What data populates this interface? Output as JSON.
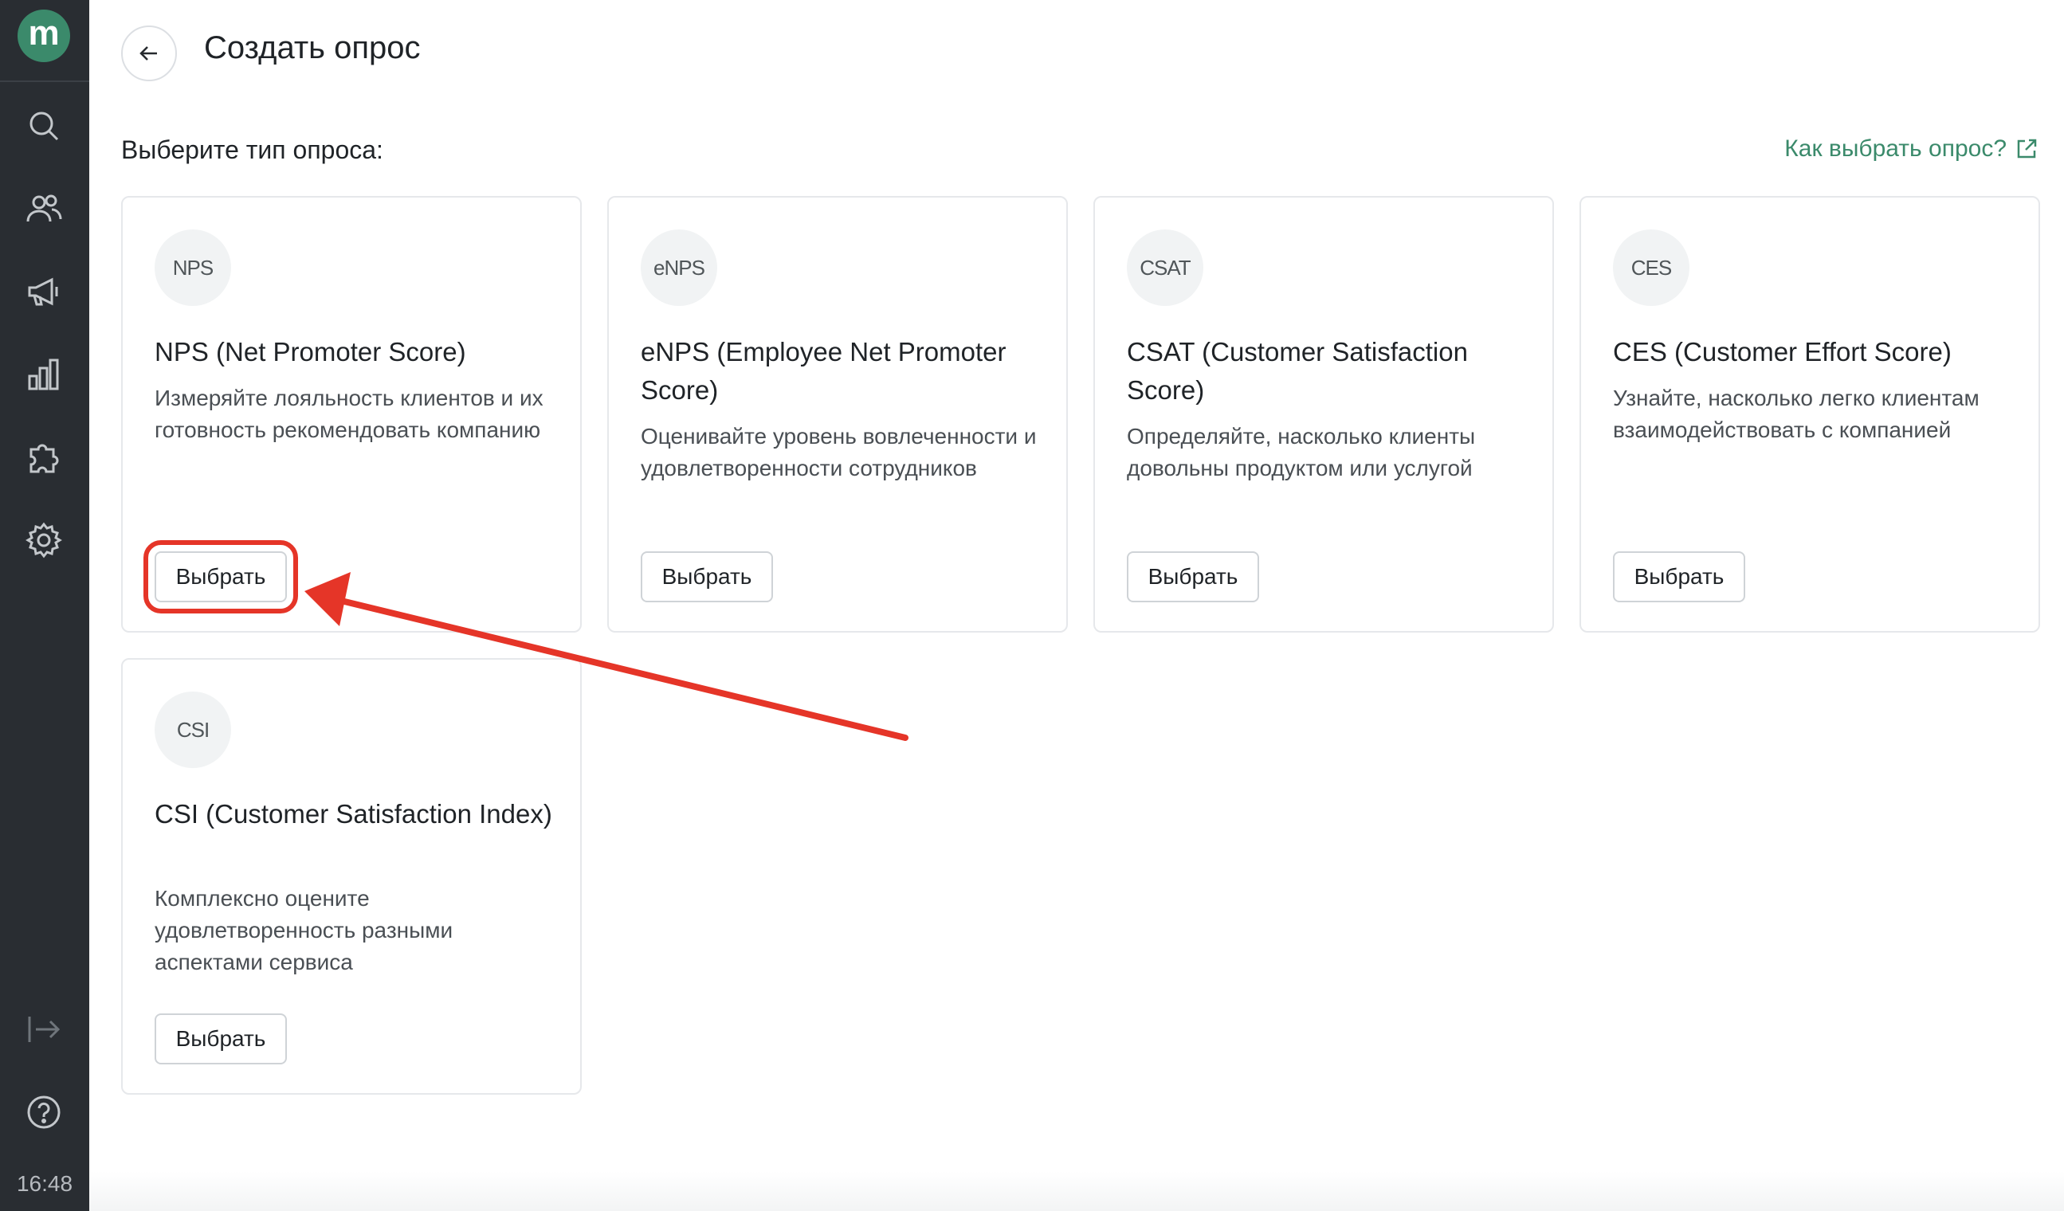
{
  "sidebar": {
    "logo_text": "m",
    "icons": [
      "search-icon",
      "users-icon",
      "megaphone-icon",
      "chart-icon",
      "puzzle-icon",
      "gear-icon",
      "logout-icon",
      "help-icon"
    ],
    "time": "16:48"
  },
  "header": {
    "title": "Создать опрос"
  },
  "main": {
    "subtitle": "Выберите тип опроса:",
    "help_link": "Как выбрать опрос?",
    "cards": [
      {
        "badge": "NPS",
        "title": "NPS (Net Promoter Score)",
        "description": "Измеряйте лояльность клиентов и их готовность рекомендовать компанию",
        "button": "Выбрать"
      },
      {
        "badge": "eNPS",
        "title": "eNPS (Employee Net Promoter Score)",
        "description": "Оценивайте уровень вовлеченности и удовлетворенности сотрудников",
        "button": "Выбрать"
      },
      {
        "badge": "CSAT",
        "title": "CSAT (Customer Satisfaction Score)",
        "description": "Определяйте, насколько клиенты довольны продуктом или услугой",
        "button": "Выбрать"
      },
      {
        "badge": "CES",
        "title": "CES (Customer Effort Score)",
        "description": "Узнайте, насколько легко клиентам взаимодействовать с компанией",
        "button": "Выбрать"
      },
      {
        "badge": "CSI",
        "title": "CSI (Customer Satisfaction Index)",
        "description": "Комплексно оцените удовлетворенность разными аспектами сервиса",
        "button": "Выбрать"
      }
    ]
  },
  "colors": {
    "sidebar_bg": "#292d32",
    "accent_green": "#3b8a6b",
    "annotation_red": "#e53528"
  }
}
